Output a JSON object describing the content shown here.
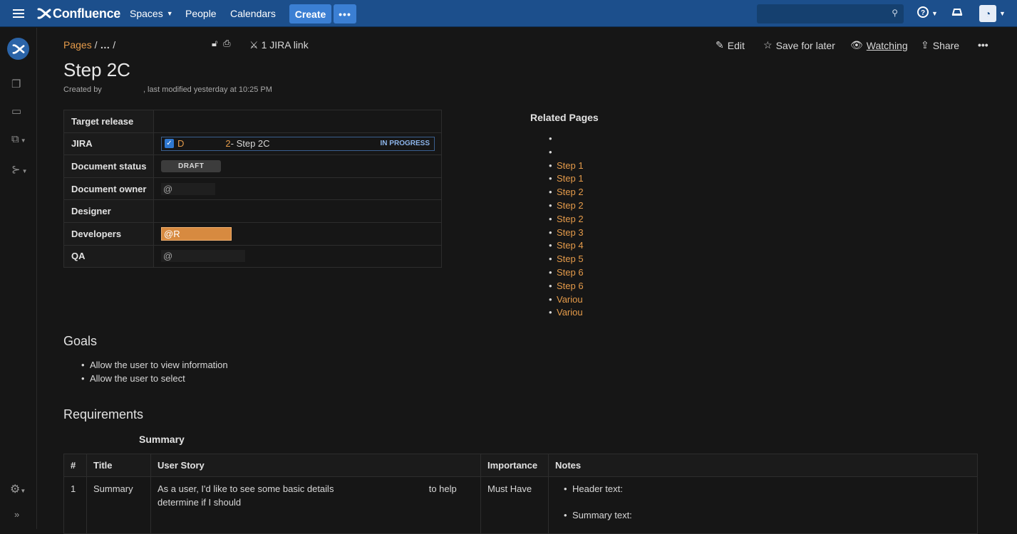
{
  "topnav": {
    "logo_text": "Confluence",
    "spaces": "Spaces",
    "people": "People",
    "calendars": "Calendars",
    "create": "Create",
    "more": "•••"
  },
  "breadcrumb": {
    "pages": "Pages",
    "sep1": "/",
    "ellipsis": "…",
    "sep2": "/"
  },
  "page": {
    "jira_link": "1 JIRA link",
    "title": "Step 2C",
    "byline_created": "Created by",
    "byline_modified": ", last modified yesterday at 10:25 PM"
  },
  "actions": {
    "edit": "Edit",
    "save_for_later": "Save for later",
    "watching": "Watching",
    "share": "Share",
    "more": "•••"
  },
  "properties": {
    "target_release": "Target release",
    "jira": "JIRA",
    "jira_key": "D",
    "jira_key_suffix": "2",
    "jira_summary": " - Step 2C",
    "jira_status": "IN PROGRESS",
    "doc_status": "Document status",
    "doc_status_value": "DRAFT",
    "doc_owner": "Document owner",
    "doc_owner_value": "@",
    "designer": "Designer",
    "developers": "Developers",
    "developers_value": "@R",
    "qa": "QA",
    "qa_value": "@"
  },
  "related": {
    "title": "Related Pages",
    "items": [
      "",
      "",
      "Step 1",
      "Step 1",
      "Step 2",
      "Step 2",
      "Step 2",
      "Step 3",
      "Step 4",
      "Step 5",
      "Step 6",
      "Step 6",
      "Variou",
      "Variou"
    ]
  },
  "goals": {
    "heading": "Goals",
    "items": [
      "Allow the user to view information",
      "Allow the user to select"
    ]
  },
  "requirements": {
    "heading": "Requirements",
    "summary_heading": "Summary",
    "columns": [
      "#",
      "Title",
      "User Story",
      "Importance",
      "Notes"
    ],
    "rows": [
      {
        "num": "1",
        "title": "Summary",
        "story_a": "As a user, I'd like to see some basic details",
        "story_b": "to help",
        "story_c": "determine if I should",
        "importance": "Must Have",
        "note_1": "Header text:",
        "note_2": "Summary text:"
      }
    ]
  },
  "icons": {
    "search": "search-icon",
    "help": "help-icon",
    "notifications": "bell-icon",
    "settings": "gear-icon"
  },
  "colors": {
    "nav_bg": "#1c4f8c",
    "accent": "#3b7fd3",
    "link": "#e59b4a",
    "page_bg": "#161616"
  }
}
